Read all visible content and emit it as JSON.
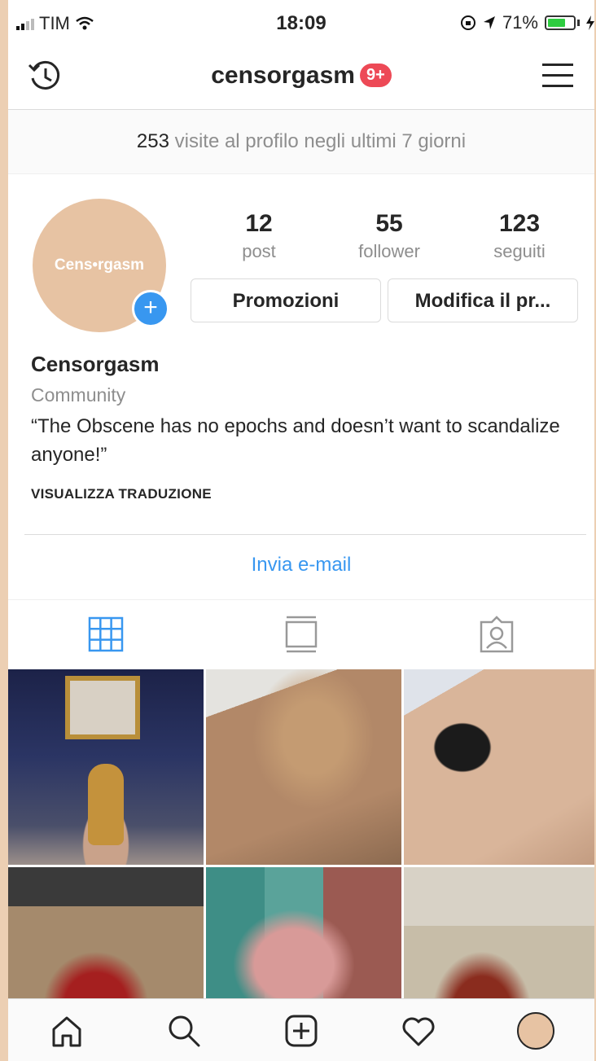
{
  "status_bar": {
    "carrier": "TIM",
    "time": "18:09",
    "battery": "71%",
    "battery_level": 0.71
  },
  "header": {
    "username": "censorgasm",
    "notification_badge": "9+"
  },
  "visits": {
    "count": "253",
    "text": "visite al profilo negli ultimi 7 giorni"
  },
  "profile": {
    "avatar_text": "Cens•rgasm",
    "stats": [
      {
        "num": "12",
        "label": "post"
      },
      {
        "num": "55",
        "label": "follower"
      },
      {
        "num": "123",
        "label": "seguiti"
      }
    ],
    "promo_button": "Promozioni",
    "edit_button": "Modifica il pr...",
    "name": "Censorgasm",
    "category": "Community",
    "bio": "“The Obscene has no epochs and doesn’t want to scandalize anyone!”",
    "translate_link": "VISUALIZZA TRADUZIONE",
    "email_button": "Invia e-mail"
  },
  "tabs": [
    "grid-icon",
    "feed-icon",
    "tagged-icon"
  ],
  "bottom_nav": [
    "home-icon",
    "search-icon",
    "add-icon",
    "heart-icon",
    "profile-avatar"
  ],
  "colors": {
    "accent_blue": "#3897f0",
    "badge_red": "#ed4956",
    "avatar_peach": "#e7c3a3"
  }
}
